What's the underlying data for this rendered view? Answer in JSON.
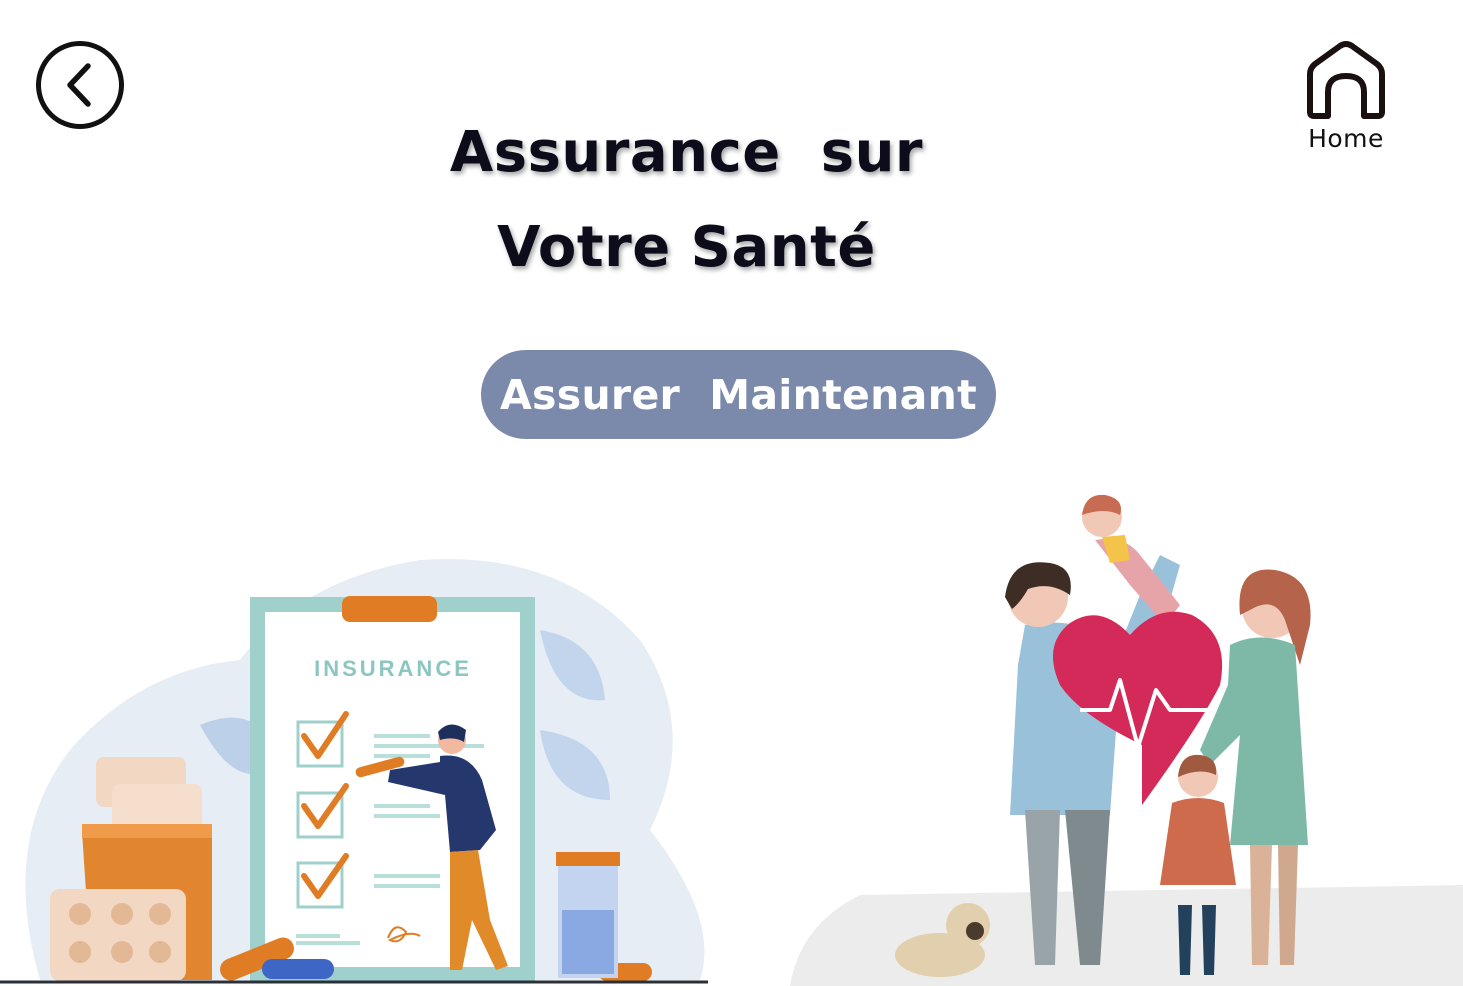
{
  "nav": {
    "back_icon": "chevron-left-icon",
    "home_icon": "home-icon",
    "home_label": "Home"
  },
  "header": {
    "title_line1": "Assurance  sur",
    "title_line2": "Votre Santé"
  },
  "cta": {
    "label": "Assurer  Maintenant",
    "color": "#7b8aab"
  },
  "illustration_left": {
    "clipboard_text": "INSURANCE"
  },
  "colors": {
    "heart": "#d42a5a",
    "accent_orange": "#e07c24",
    "clipboard_frame": "#9fd0cc"
  }
}
